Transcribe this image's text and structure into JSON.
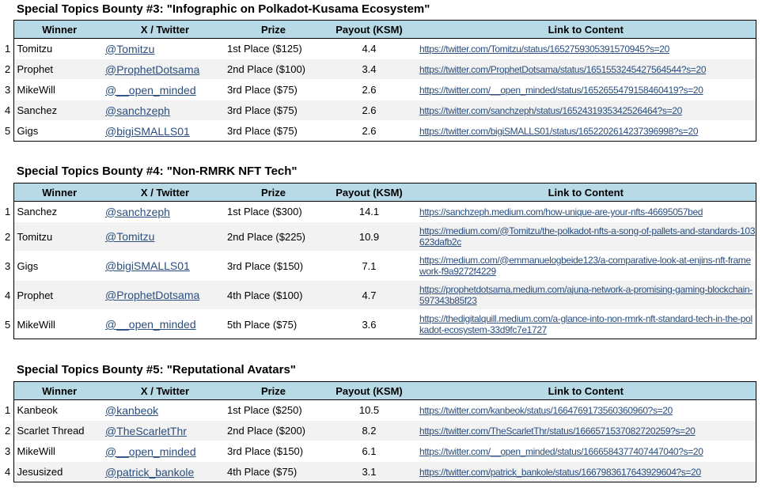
{
  "columns": [
    "Winner",
    "X / Twitter",
    "Prize",
    "Payout (KSM)",
    "Link to Content"
  ],
  "bounties": [
    {
      "title": "Special Topics Bounty #3: \"Infographic on Polkadot-Kusama Ecosystem\"",
      "rows": [
        {
          "n": "1",
          "winner": "Tomitzu",
          "handle": "@Tomitzu",
          "prize": "1st Place ($125)",
          "payout": "4.4",
          "link": "https://twitter.com/Tomitzu/status/1652759305391570945?s=20"
        },
        {
          "n": "2",
          "winner": "Prophet",
          "handle": "@ProphetDotsama",
          "prize": "2nd Place ($100)",
          "payout": "3.4",
          "link": "https://twitter.com/ProphetDotsama/status/1651553245427564544?s=20"
        },
        {
          "n": "3",
          "winner": "MikeWill",
          "handle": "@__open_minded",
          "prize": "3rd Place ($75)",
          "payout": "2.6",
          "link": "https://twitter.com/__open_minded/status/1652655479158460419?s=20"
        },
        {
          "n": "4",
          "winner": "Sanchez",
          "handle": "@sanchzeph",
          "prize": "3rd Place ($75)",
          "payout": "2.6",
          "link": "https://twitter.com/sanchzeph/status/1652431935342526464?s=20"
        },
        {
          "n": "5",
          "winner": "Gigs",
          "handle": "@bigiSMALLS01",
          "prize": "3rd Place ($75)",
          "payout": "2.6",
          "link": "https://twitter.com/bigiSMALLS01/status/1652202614237396998?s=20"
        }
      ]
    },
    {
      "title": "Special Topics Bounty #4: \"Non-RMRK NFT Tech\"",
      "rows": [
        {
          "n": "1",
          "winner": "Sanchez",
          "handle": "@sanchzeph",
          "prize": "1st Place ($300)",
          "payout": "14.1",
          "link": "https://sanchzeph.medium.com/how-unique-are-your-nfts-46695057bed"
        },
        {
          "n": "2",
          "winner": "Tomitzu",
          "handle": "@Tomitzu",
          "prize": "2nd Place ($225)",
          "payout": "10.9",
          "link": "https://medium.com/@Tomitzu/the-polkadot-nfts-a-song-of-pallets-and-standards-103623dafb2c"
        },
        {
          "n": "3",
          "winner": "Gigs",
          "handle": "@bigiSMALLS01",
          "prize": "3rd Place ($150)",
          "payout": "7.1",
          "link": "https://medium.com/@emmanuelogbeide123/a-comparative-look-at-enjins-nft-framework-f9a9272f4229"
        },
        {
          "n": "4",
          "winner": "Prophet",
          "handle": "@ProphetDotsama",
          "prize": "4th Place ($100)",
          "payout": "4.7",
          "link": "https://prophetdotsama.medium.com/ajuna-network-a-promising-gaming-blockchain-597343b85f23"
        },
        {
          "n": "5",
          "winner": "MikeWill",
          "handle": "@__open_minded",
          "prize": "5th Place ($75)",
          "payout": "3.6",
          "link": "https://thedigitalquill.medium.com/a-glance-into-non-rmrk-nft-standard-tech-in-the-polkadot-ecosystem-33d9fc7e1727"
        }
      ]
    },
    {
      "title": "Special Topics Bounty #5: \"Reputational Avatars\"",
      "rows": [
        {
          "n": "1",
          "winner": "Kanbeok",
          "handle": "@kanbeok",
          "prize": "1st Place ($250)",
          "payout": "10.5",
          "link": "https://twitter.com/kanbeok/status/1664769173560360960?s=20"
        },
        {
          "n": "2",
          "winner": "Scarlet Thread",
          "handle": "@TheScarletThr",
          "prize": "2nd Place ($200)",
          "payout": "8.2",
          "link": "https://twitter.com/TheScarletThr/status/1666571537082720259?s=20"
        },
        {
          "n": "3",
          "winner": "MikeWill",
          "handle": "@__open_minded",
          "prize": "3rd Place ($150)",
          "payout": "6.1",
          "link": "https://twitter.com/__open_minded/status/1666584377407447040?s=20"
        },
        {
          "n": "4",
          "winner": "Jesusized",
          "handle": "@patrick_bankole",
          "prize": "4th Place ($75)",
          "payout": "3.1",
          "link": "https://twitter.com/patrick_bankole/status/1667983617643929604?s=20"
        }
      ]
    }
  ]
}
